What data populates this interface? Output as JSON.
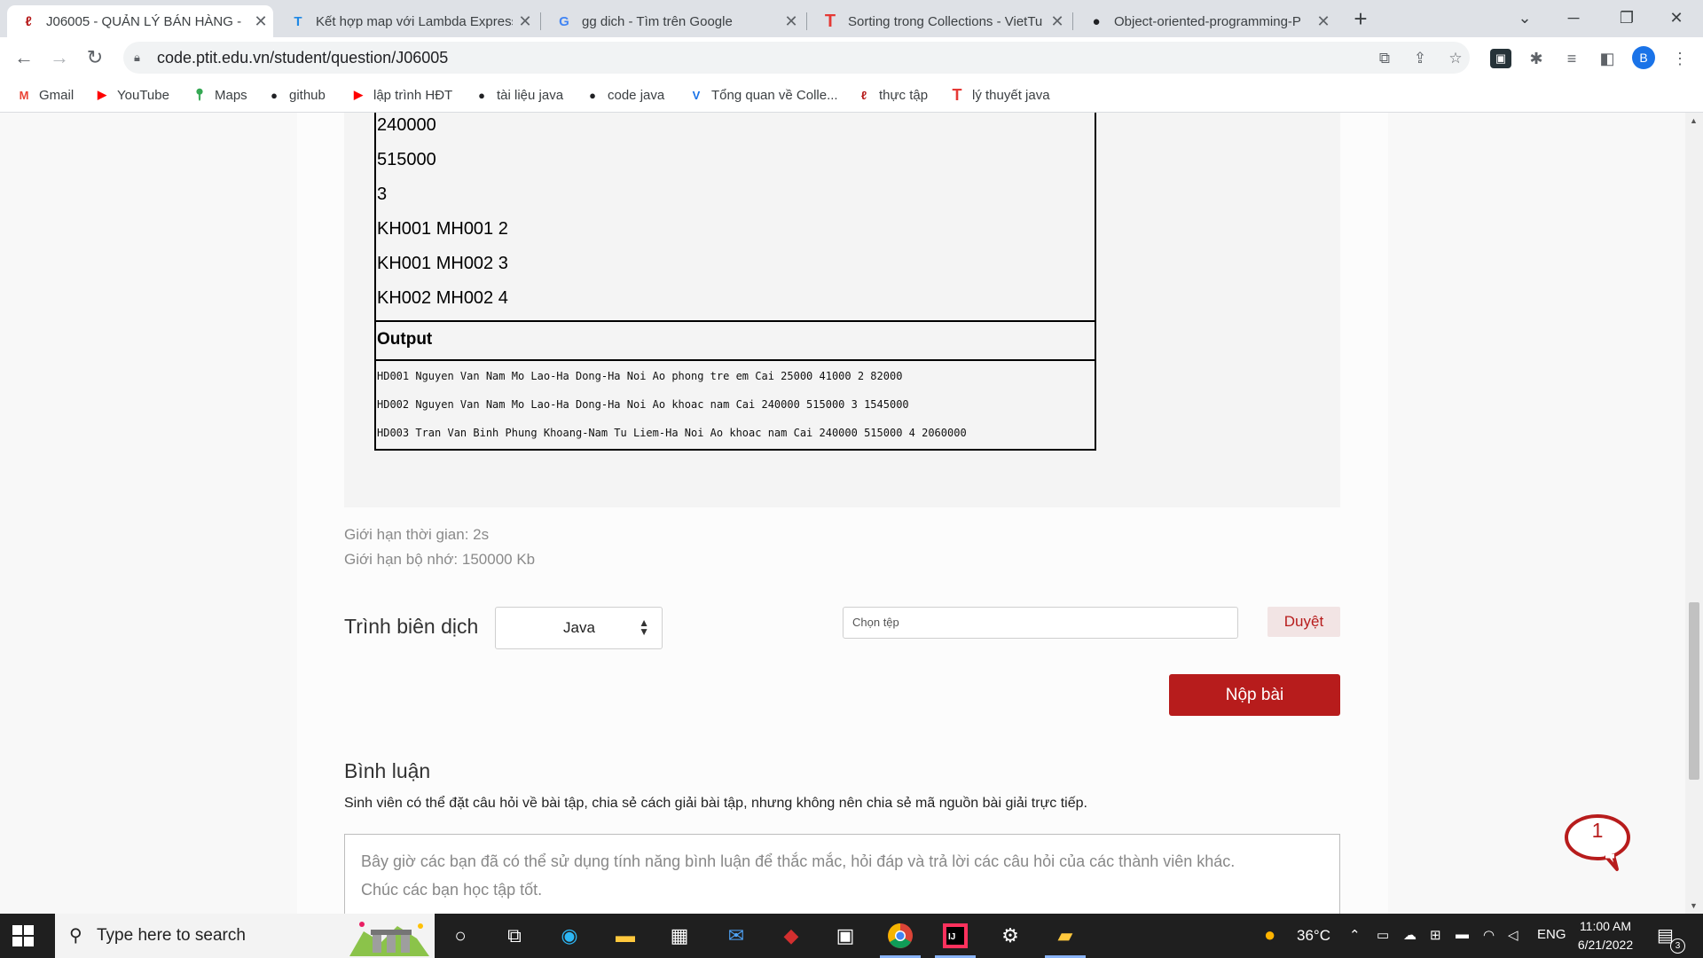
{
  "browser": {
    "tabs": [
      {
        "title": "J06005 - QUẢN LÝ BÁN HÀNG -",
        "icon": "ptit-icon",
        "active": true
      },
      {
        "title": "Kết hợp map với Lambda Express",
        "icon": "tf-icon"
      },
      {
        "title": "gg dich - Tìm trên Google",
        "icon": "google-icon"
      },
      {
        "title": "Sorting trong Collections - VietTu",
        "icon": "viettuts-icon"
      },
      {
        "title": "Object-oriented-programming-P",
        "icon": "github-icon"
      }
    ],
    "url": "code.ptit.edu.vn/student/question/J06005",
    "profile_initial": "B",
    "bookmarks": [
      {
        "label": "Gmail",
        "icon": "gmail-icon",
        "color": "#ea4335"
      },
      {
        "label": "YouTube",
        "icon": "youtube-icon",
        "color": "#ff0000"
      },
      {
        "label": "Maps",
        "icon": "maps-icon",
        "color": "#34a853"
      },
      {
        "label": "github",
        "icon": "github-icon",
        "color": "#202124"
      },
      {
        "label": "lập trình HĐT",
        "icon": "youtube-icon",
        "color": "#ff0000"
      },
      {
        "label": "tài liệu java",
        "icon": "github-icon",
        "color": "#202124"
      },
      {
        "label": "code java",
        "icon": "github-icon",
        "color": "#202124"
      },
      {
        "label": "Tổng quan về Colle...",
        "icon": "v-icon",
        "color": "#1a73e8"
      },
      {
        "label": "thực tập",
        "icon": "ptit-icon",
        "color": "#b71c1c"
      },
      {
        "label": "lý thuyết java",
        "icon": "viettuts-icon",
        "color": "#e53935"
      }
    ]
  },
  "sample": {
    "input_lines": [
      "240000",
      "515000",
      "3",
      "KH001 MH001 2",
      "KH001 MH002 3",
      "KH002 MH002 4"
    ],
    "output_label": "Output",
    "output_lines": [
      "HD001 Nguyen Van Nam Mo Lao-Ha Dong-Ha Noi Ao phong tre em Cai 25000 41000 2 82000",
      "HD002 Nguyen Van Nam Mo Lao-Ha Dong-Ha Noi Ao khoac nam Cai 240000 515000 3 1545000",
      "HD003 Tran Van Binh Phung Khoang-Nam Tu Liem-Ha Noi Ao khoac nam Cai 240000 515000 4 2060000"
    ]
  },
  "limits": {
    "time": "Giới hạn thời gian: 2s",
    "memory": "Giới hạn bộ nhớ: 150000 Kb"
  },
  "submit_form": {
    "compiler_label": "Trình biên dịch",
    "language": "Java",
    "file_placeholder": "Chọn tệp",
    "browse_label": "Duyệt",
    "submit_label": "Nộp bài"
  },
  "comments": {
    "title": "Bình luận",
    "note": "Sinh viên có thể đặt câu hỏi về bài tập, chia sẻ cách giải bài tập, nhưng không nên chia sẻ mã nguồn bài giải trực tiếp.",
    "placeholder_line1": "Bây giờ các bạn đã có thể sử dụng tính năng bình luận để thắc mắc, hỏi đáp và trả lời các câu hỏi của các thành viên khác.",
    "placeholder_line2": "Chúc các bạn học tập tốt.",
    "badge_count": "1"
  },
  "taskbar": {
    "search_placeholder": "Type here to search",
    "weather": "36°C",
    "language": "ENG",
    "time": "11:00 AM",
    "date": "6/21/2022",
    "notifications": "3"
  },
  "colors": {
    "accent": "#b71c1c",
    "browse_bg": "#f2e4e4"
  }
}
